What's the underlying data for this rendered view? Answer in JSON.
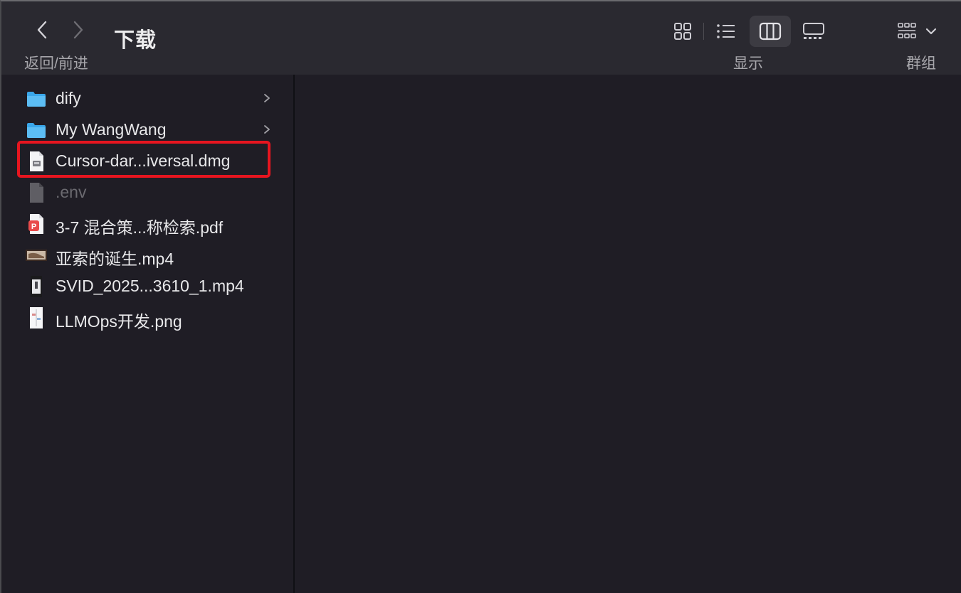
{
  "window": {
    "title": "下载",
    "nav_label": "返回/前进",
    "view_label": "显示",
    "group_label": "群组"
  },
  "toolbar": {
    "views": [
      {
        "name": "icon-view",
        "active": false
      },
      {
        "name": "list-view",
        "active": false
      },
      {
        "name": "column-view",
        "active": true
      },
      {
        "name": "gallery-view",
        "active": false
      }
    ]
  },
  "files": [
    {
      "name": "dify",
      "type": "folder",
      "has_children": true
    },
    {
      "name": "My WangWang",
      "type": "folder",
      "has_children": true
    },
    {
      "name": "Cursor-dar...iversal.dmg",
      "type": "dmg",
      "highlighted": true
    },
    {
      "name": ".env",
      "type": "hidden-file",
      "dim": true
    },
    {
      "name": "3-7 混合策...称检索.pdf",
      "type": "pdf"
    },
    {
      "name": "亚索的诞生.mp4",
      "type": "video"
    },
    {
      "name": "SVID_2025...3610_1.mp4",
      "type": "video-portrait"
    },
    {
      "name": "LLMOps开发.png",
      "type": "image"
    }
  ],
  "colors": {
    "folder": "#3aa7ea",
    "highlight_border": "#e6151f",
    "background": "#1f1d25",
    "toolbar": "#2a2930"
  }
}
